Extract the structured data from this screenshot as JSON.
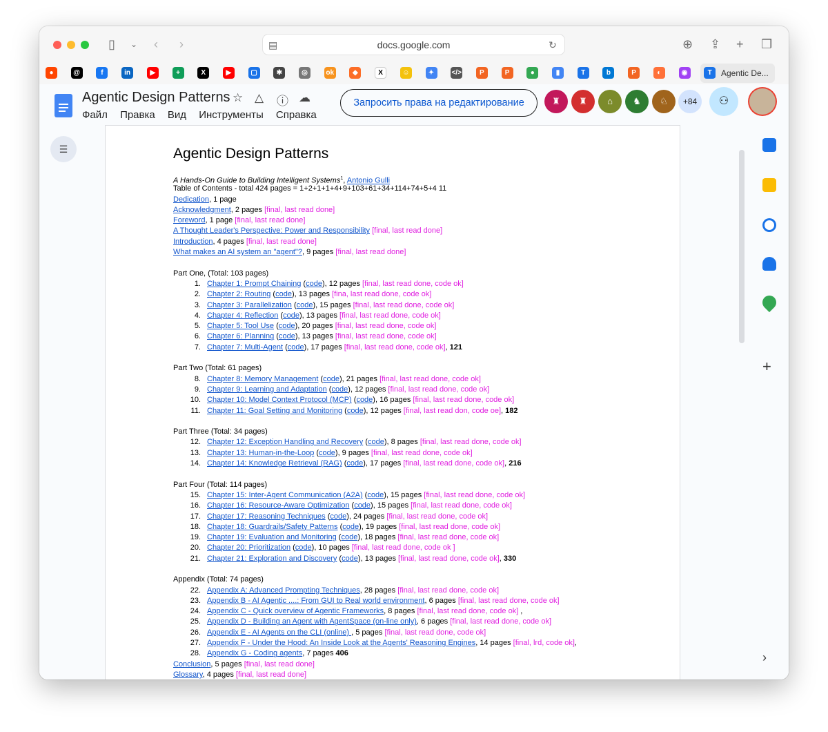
{
  "browser": {
    "url": "docs.google.com",
    "active_tab": "Agentic De...",
    "favorites": [
      {
        "icon": "reddit-icon",
        "color": "#ff4500",
        "glyph": "●"
      },
      {
        "icon": "threads-icon",
        "color": "#000000",
        "glyph": "@"
      },
      {
        "icon": "facebook-icon",
        "color": "#1877f2",
        "glyph": "f"
      },
      {
        "icon": "linkedin-icon",
        "color": "#0a66c2",
        "glyph": "in"
      },
      {
        "icon": "youtube-icon",
        "color": "#ff0000",
        "glyph": "▶"
      },
      {
        "icon": "sheets-icon",
        "color": "#0f9d58",
        "glyph": "+"
      },
      {
        "icon": "x-icon",
        "color": "#000000",
        "glyph": "X"
      },
      {
        "icon": "youtube-icon",
        "color": "#ff0000",
        "glyph": "▶"
      },
      {
        "icon": "chat-icon",
        "color": "#1a73e8",
        "glyph": "▢"
      },
      {
        "icon": "openai-icon",
        "color": "#444444",
        "glyph": "✱"
      },
      {
        "icon": "compass-icon",
        "color": "#777777",
        "glyph": "◎"
      },
      {
        "icon": "ok-icon",
        "color": "#f7931e",
        "glyph": "ok"
      },
      {
        "icon": "gitlab-icon",
        "color": "#fc6d26",
        "glyph": "◆"
      },
      {
        "icon": "x-tab-icon",
        "color": "#ffffff",
        "glyph": "X"
      },
      {
        "icon": "emoji-icon",
        "color": "#f4c20d",
        "glyph": "☺"
      },
      {
        "icon": "gemini-icon",
        "color": "#4285f4",
        "glyph": "✦"
      },
      {
        "icon": "code-icon",
        "color": "#555555",
        "glyph": "</>"
      },
      {
        "icon": "p-icon",
        "color": "#f26522",
        "glyph": "P"
      },
      {
        "icon": "p-icon",
        "color": "#f26522",
        "glyph": "P"
      },
      {
        "icon": "circle-icon",
        "color": "#34a853",
        "glyph": "●"
      },
      {
        "icon": "analytics-icon",
        "color": "#4285f4",
        "glyph": "▮"
      },
      {
        "icon": "t-icon",
        "color": "#1a73e8",
        "glyph": "T"
      },
      {
        "icon": "bing-icon",
        "color": "#0078d4",
        "glyph": "b"
      },
      {
        "icon": "p-icon",
        "color": "#f26522",
        "glyph": "P"
      },
      {
        "icon": "firefox-icon",
        "color": "#ff7139",
        "glyph": "◐"
      },
      {
        "icon": "rainbow-icon",
        "color": "#a142f4",
        "glyph": "◉"
      },
      {
        "icon": "t-icon",
        "color": "#1a73e8",
        "glyph": "T"
      }
    ]
  },
  "docs": {
    "title": "Agentic Design Patterns",
    "menu": [
      "Файл",
      "Правка",
      "Вид",
      "Инструменты",
      "Справка"
    ],
    "request_edit": "Запросить права на редактирование",
    "more_viewers": "+84",
    "viewers": [
      {
        "color": "#c2185b",
        "glyph": "♜"
      },
      {
        "color": "#d32f2f",
        "glyph": "♜"
      },
      {
        "color": "#7c8b2b",
        "glyph": "⌂"
      },
      {
        "color": "#2e7d32",
        "glyph": "♞"
      },
      {
        "color": "#a0641c",
        "glyph": "♘"
      }
    ]
  },
  "doc": {
    "heading": "Agentic Design Patterns",
    "subtitle": "A Hands-On Guide to Building Intelligent Systems",
    "subtitle_sup": "1",
    "sep": ", ",
    "author": "Antonio Gulli",
    "toc": "Table of Contents - total 424 pages  = 1+2+1+1+4+9+103+61+34+114+74+5+4 11",
    "front": [
      {
        "link": "Dedication",
        "mid": ", 1 page",
        "status": ""
      },
      {
        "link": "Acknowledgment",
        "mid": ", 2 pages  ",
        "status": "[final, last read done]"
      },
      {
        "link": "Foreword",
        "mid": ", 1 page   ",
        "status": "[final, last read done]"
      },
      {
        "link": "A Thought Leader's Perspective: Power and Responsibility",
        "mid": "   ",
        "status": "[final, last read done]"
      },
      {
        "link": "Introduction",
        "mid": ", 4 pages ",
        "status": "[final, last read done]"
      },
      {
        "link": "What makes an AI system an \"agent\"?",
        "mid": ", 9 pages ",
        "status": "[final, last read done]"
      }
    ],
    "parts": [
      {
        "title": "Part One, (Total: 103 pages)",
        "items": [
          {
            "n": "1.",
            "link": "Chapter 1: Prompt Chaining",
            "pages": "), 12 pages ",
            "status": "[final, last read done, code ok]",
            "total": ""
          },
          {
            "n": "2.",
            "link": "Chapter 2: Routing",
            "pages": "), 13 pages ",
            "status": "[fina, last read done, code ok]",
            "total": ""
          },
          {
            "n": "3.",
            "link": "Chapter 3: Parallelization",
            "pages": "), 15 pages ",
            "status": "[final, last read done, code ok]",
            "total": ""
          },
          {
            "n": "4.",
            "link": "Chapter 4: Reflection",
            "pages": "), 13 pages ",
            "status": "[final, last read done, code ok]",
            "total": ""
          },
          {
            "n": "5.",
            "link": "Chapter 5: Tool Use",
            "pages": "), 20 pages ",
            "status": "[final, last read done, code ok]",
            "total": ""
          },
          {
            "n": "6.",
            "link": "Chapter 6: Planning",
            "pages": "), 13 pages ",
            "status": "[final, last read done, code ok]",
            "total": ""
          },
          {
            "n": "7.",
            "link": "Chapter 7: Multi-Agent",
            "pages": "), 17 pages ",
            "status": "[final,  last read done, code ok]",
            "total": "121"
          }
        ]
      },
      {
        "title": "Part Two (Total: 61 pages)",
        "items": [
          {
            "n": "8.",
            "link": "Chapter 8: Memory Management",
            "pages": "), 21 pages ",
            "status": "[final, last read done, code ok]",
            "total": ""
          },
          {
            "n": "9.",
            "link": "Chapter 9: Learning and Adaptation",
            "pages": "), 12 pages ",
            "status": "[final, last read done, code ok]",
            "total": ""
          },
          {
            "n": "10.",
            "link": "Chapter 10: Model Context Protocol (MCP)",
            "pages": "), 16 pages  ",
            "status": "[final, last read done, code ok]",
            "total": ""
          },
          {
            "n": "11.",
            "link": "Chapter 11: Goal Setting and Monitoring",
            "pages": "), 12 pages ",
            "status": "[final, last read don, code oe]",
            "total": "182"
          }
        ]
      },
      {
        "title": "Part Three (Total: 34 pages)",
        "items": [
          {
            "n": "12.",
            "link": "Chapter 12: Exception Handling and Recovery",
            "pages": "), 8 pages ",
            "status": "[final,  last read done, code ok]",
            "total": ""
          },
          {
            "n": "13.",
            "link": "Chapter 13: Human-in-the-Loop",
            "pages": "), 9 pages ",
            "status": "[final, last read done, code ok]",
            "total": ""
          },
          {
            "n": "14.",
            "link": "Chapter 14: Knowledge Retrieval (RAG)",
            "pages": "), 17 pages ",
            "status": "[final, last read done, code ok]",
            "total": "216"
          }
        ]
      },
      {
        "title": "Part Four (Total: 114 pages)",
        "items": [
          {
            "n": "15.",
            "link": "Chapter 15: Inter-Agent Communication (A2A)",
            "pages": "), 15 pages ",
            "status": "[final, last read done, code ok]",
            "total": ""
          },
          {
            "n": "16.",
            "link": "Chapter 16: Resource-Aware Optimization",
            "pages": "), 15 pages  ",
            "status": "[final,  last read done, code ok]",
            "total": ""
          },
          {
            "n": "17.",
            "link": "Chapter 17: Reasoning Techniques",
            "pages": "), 24 pages ",
            "status": "[final,  last read done, code ok]",
            "total": ""
          },
          {
            "n": "18.",
            "link": "Chapter 18: Guardrails/Safety Patterns",
            "pages": "), 19 pages ",
            "status": "[final, last read done, code ok]",
            "total": ""
          },
          {
            "n": "19.",
            "link": "Chapter 19: Evaluation and Monitoring",
            "pages": "), 18 pages ",
            "status": "[final, last read done, code ok]",
            "total": ""
          },
          {
            "n": "20.",
            "link": "Chapter 20: Prioritization",
            "pages": "), 10 pages ",
            "status": "[final, last read done, code ok ]",
            "total": ""
          },
          {
            "n": "21.",
            "link": "Chapter 21: Exploration and Discovery",
            "pages": "), 13 pages ",
            "status": "[final, last read done, code ok]",
            "total": "330"
          }
        ]
      }
    ],
    "code_label": "code",
    "open_paren": " (",
    "appendix_title": "Appendix (Total: 74 pages)",
    "appendix": [
      {
        "n": "22.",
        "link": "Appendix A: Advanced Prompting Techniques",
        "mid": ", 28 pages ",
        "status": "[final, last read done, code ok]",
        "tail": ""
      },
      {
        "n": "23.",
        "link": "Appendix B - AI Agentic ....: From GUI to Real world environment",
        "mid": ", 6 pages ",
        "status": "[final, last read done, code ok]",
        "tail": ""
      },
      {
        "n": "24.",
        "link": "Appendix C - Quick overview of Agentic Frameworks",
        "mid": ", 8 pages ",
        "status": "[final, last read done, code ok]",
        "tail": " ,"
      },
      {
        "n": "25.",
        "link": "Appendix D - Building an Agent with AgentSpace (on-line only)",
        "mid": ", 6 pages ",
        "status": "[final, last read done, code ok]",
        "tail": ""
      },
      {
        "n": "26.",
        "link": "Appendix E - AI Agents on the CLI (online) ",
        "mid": ", 5 pages ",
        "status": "[final, last read done, code ok]",
        "tail": ""
      },
      {
        "n": "27.",
        "link": "Appendix F - Under the Hood: An Inside Look at the Agents' Reasoning Engines",
        "mid": ", 14 pages ",
        "status": "[final, lrd, code ok]",
        "tail": ","
      },
      {
        "n": "28.",
        "link": "Appendix G -  Coding agents",
        "mid": ", 7 pages  ",
        "status": "",
        "tail": "406"
      }
    ],
    "conclusion": {
      "link": "Conclusion",
      "mid": ", 5 pages ",
      "status": "[final, last read done]"
    },
    "glossary": {
      "link": "Glossary",
      "mid": ", 4 pages  ",
      "status": "[final, last read done]"
    }
  }
}
